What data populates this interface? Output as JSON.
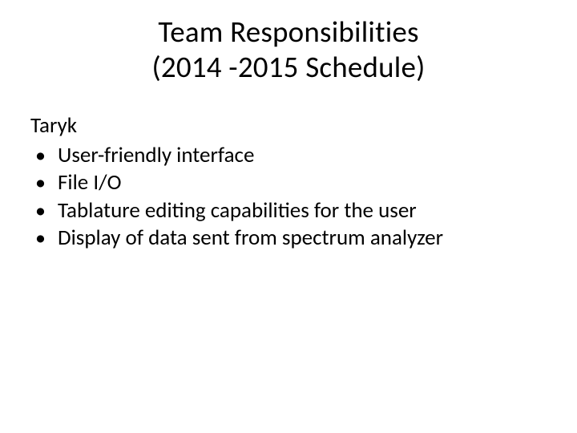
{
  "title": {
    "line1": "Team Responsibilities",
    "line2": "(2014 -2015 Schedule)"
  },
  "section": {
    "person": "Taryk",
    "items": [
      "User-friendly interface",
      "File I/O",
      "Tablature editing capabilities for the user",
      "Display of data sent from spectrum analyzer"
    ]
  }
}
